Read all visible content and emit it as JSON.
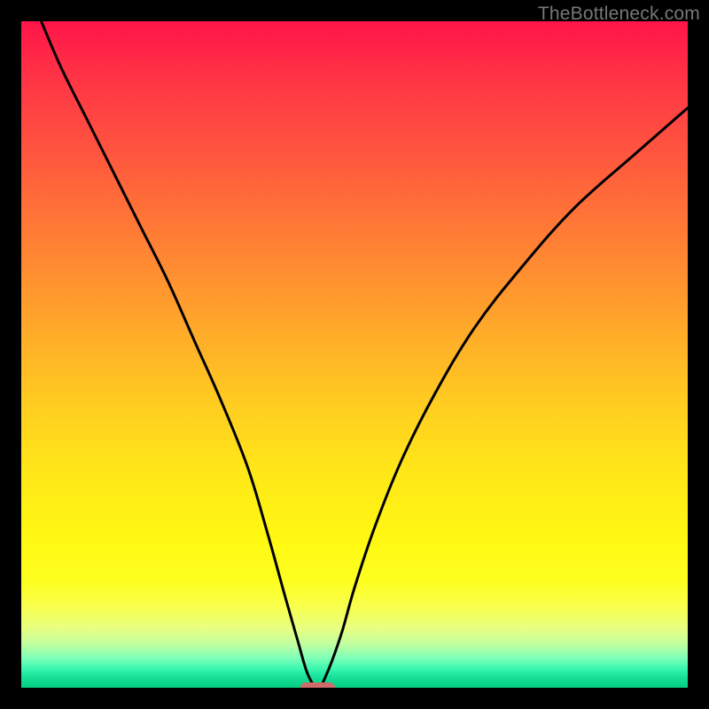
{
  "watermark": "TheBottleneck.com",
  "chart_data": {
    "type": "line",
    "title": "",
    "xlabel": "",
    "ylabel": "",
    "xlim": [
      0,
      100
    ],
    "ylim": [
      0,
      100
    ],
    "series": [
      {
        "name": "bottleneck-curve",
        "x": [
          3,
          6,
          10,
          14,
          18,
          22,
          26,
          30,
          34,
          37,
          39.5,
          41.5,
          43,
          44.5,
          45.8,
          48,
          50,
          53,
          57,
          62,
          68,
          75,
          83,
          92,
          100
        ],
        "values": [
          100,
          93,
          85,
          77,
          69,
          61,
          52,
          43,
          33,
          23,
          14,
          7,
          2,
          0,
          2,
          8,
          15,
          24,
          34,
          44,
          54,
          63,
          72,
          80,
          87
        ]
      }
    ],
    "marker": {
      "x": 44.5,
      "y": 0,
      "width_pct": 5.2,
      "height_pct": 1.6
    },
    "gradient_stops": [
      {
        "pct": 0,
        "color": "#ff1449"
      },
      {
        "pct": 50,
        "color": "#ffc020"
      },
      {
        "pct": 88,
        "color": "#f8ff50"
      },
      {
        "pct": 100,
        "color": "#00d080"
      }
    ]
  }
}
